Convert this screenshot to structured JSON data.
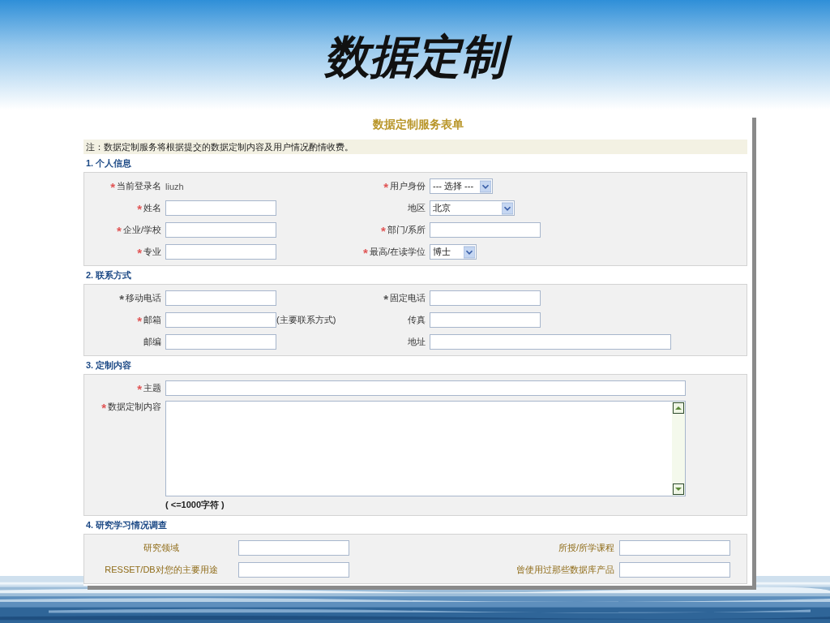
{
  "slide_title": "数据定制",
  "form": {
    "title": "数据定制服务表单",
    "note": "注：数据定制服务将根据提交的数据定制内容及用户情况酌情收费。",
    "sections": [
      {
        "heading": "1. 个人信息",
        "kind": "pairs",
        "rows": [
          [
            {
              "label": "当前登录名",
              "star": "*",
              "color": "#e05555",
              "kind": "static",
              "value": "liuzh"
            },
            {
              "label": "用户身份",
              "star": "*",
              "color": "#e05555",
              "kind": "select",
              "value": "--- 选择 ---"
            }
          ],
          [
            {
              "label": "姓名",
              "star": "*",
              "color": "#e05555",
              "kind": "input"
            },
            {
              "label": "地区",
              "kind": "wide-select",
              "value": "北京"
            }
          ],
          [
            {
              "label": "企业/学校",
              "star": "*",
              "color": "#e05555",
              "kind": "input"
            },
            {
              "label": "部门/系所",
              "star": "*",
              "color": "#e05555",
              "kind": "input"
            }
          ],
          [
            {
              "label": "专业",
              "star": "*",
              "color": "#e05555",
              "kind": "input"
            },
            {
              "label": "最高/在读学位",
              "star": "*",
              "color": "#e05555",
              "kind": "narrow-select",
              "value": "博士"
            }
          ]
        ]
      },
      {
        "heading": "2. 联系方式",
        "kind": "pairs",
        "rows": [
          [
            {
              "label": "移动电话",
              "star": "*",
              "color": "#555555",
              "kind": "input"
            },
            {
              "label": "固定电话",
              "star": "*",
              "color": "#555555",
              "kind": "input"
            }
          ],
          [
            {
              "label": "邮箱",
              "star": "*",
              "color": "#e05555",
              "kind": "input",
              "note": "(主要联系方式)"
            },
            {
              "label": "传真",
              "kind": "input"
            }
          ],
          [
            {
              "label": "邮编",
              "kind": "input"
            },
            {
              "label": "地址",
              "kind": "long-input"
            }
          ]
        ]
      },
      {
        "heading": "3. 定制内容",
        "kind": "content",
        "rows": [
          [
            {
              "label": "主题",
              "star": "*",
              "color": "#e05555",
              "kind": "full-input"
            }
          ],
          [
            {
              "label": "数据定制内容",
              "star": "*",
              "color": "#e05555",
              "kind": "textarea",
              "hint": "( <=1000字符 )"
            }
          ]
        ]
      },
      {
        "heading": "4. 研究学习情况调查",
        "kind": "survey",
        "rows": [
          [
            {
              "label": "研究领域",
              "kind": "input"
            },
            {
              "label": "所授/所学课程",
              "kind": "input"
            }
          ],
          [
            {
              "label": "RESSET/DB对您的主要用途",
              "kind": "input"
            },
            {
              "label": "曾使用过那些数据库产品",
              "kind": "input"
            }
          ]
        ]
      }
    ]
  }
}
